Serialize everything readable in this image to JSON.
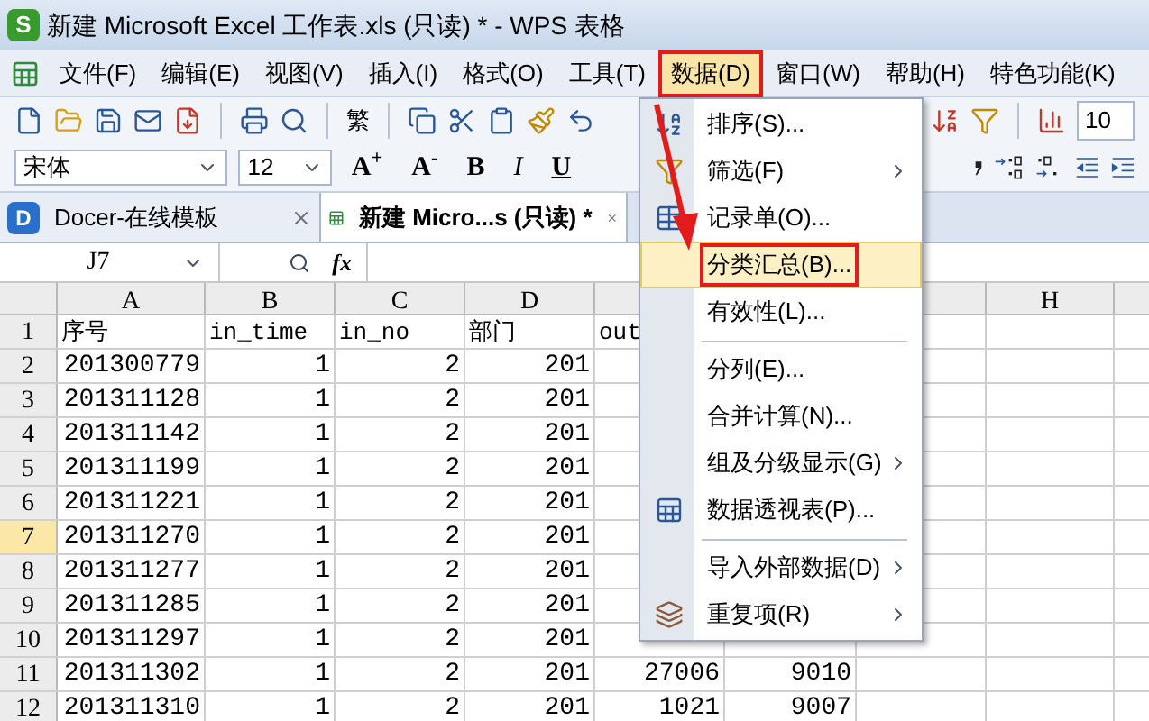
{
  "title_bar": {
    "logo_letter": "S",
    "title": "新建 Microsoft Excel 工作表.xls (只读) * - WPS 表格"
  },
  "menu_bar": [
    {
      "label": "文件(F)",
      "selected": false,
      "marked": false
    },
    {
      "label": "编辑(E)",
      "selected": false,
      "marked": false
    },
    {
      "label": "视图(V)",
      "selected": false,
      "marked": false
    },
    {
      "label": "插入(I)",
      "selected": false,
      "marked": false
    },
    {
      "label": "格式(O)",
      "selected": false,
      "marked": false
    },
    {
      "label": "工具(T)",
      "selected": false,
      "marked": false
    },
    {
      "label": "数据(D)",
      "selected": true,
      "marked": true
    },
    {
      "label": "窗口(W)",
      "selected": false,
      "marked": false
    },
    {
      "label": "帮助(H)",
      "selected": false,
      "marked": false
    },
    {
      "label": "特色功能(K)",
      "selected": false,
      "marked": false
    }
  ],
  "toolbar": {
    "traditional_button": "繁",
    "zoom_field": "10"
  },
  "format_bar": {
    "font_field": "宋体",
    "size_field": "12",
    "buttons": [
      "A$^{+}$",
      "A$^{-}$",
      "B",
      "I",
      "U"
    ]
  },
  "tabs": [
    {
      "kind": "docer",
      "logo_letter": "D",
      "label": "Docer-在线模板",
      "selected": false
    },
    {
      "kind": "workbook",
      "label": "新建 Micro...s (只读) *",
      "selected": true
    }
  ],
  "formula_bar": {
    "name_box": "J7",
    "fx": "fx"
  },
  "sheet": {
    "columns": [
      "A",
      "B",
      "C",
      "D",
      null,
      null,
      null,
      "H"
    ],
    "rows": [
      {
        "header": "1",
        "selected": false,
        "kind": "labels",
        "cells": [
          "序号",
          "in_time",
          "in_no",
          "部门",
          "out"
        ]
      },
      {
        "header": "2",
        "selected": false,
        "kind": "values",
        "cells": [
          "201300779",
          "1",
          "2",
          "201"
        ]
      },
      {
        "header": "3",
        "selected": false,
        "kind": "values",
        "cells": [
          "201311128",
          "1",
          "2",
          "201"
        ]
      },
      {
        "header": "4",
        "selected": false,
        "kind": "values",
        "cells": [
          "201311142",
          "1",
          "2",
          "201"
        ]
      },
      {
        "header": "5",
        "selected": false,
        "kind": "values",
        "cells": [
          "201311199",
          "1",
          "2",
          "201"
        ]
      },
      {
        "header": "6",
        "selected": false,
        "kind": "values",
        "cells": [
          "201311221",
          "1",
          "2",
          "201"
        ]
      },
      {
        "header": "7",
        "selected": true,
        "kind": "values",
        "cells": [
          "201311270",
          "1",
          "2",
          "201"
        ]
      },
      {
        "header": "8",
        "selected": false,
        "kind": "values",
        "cells": [
          "201311277",
          "1",
          "2",
          "201"
        ]
      },
      {
        "header": "9",
        "selected": false,
        "kind": "values",
        "cells": [
          "201311285",
          "1",
          "2",
          "201"
        ]
      },
      {
        "header": "10",
        "selected": false,
        "kind": "values",
        "cells": [
          "201311297",
          "1",
          "2",
          "201"
        ]
      },
      {
        "header": "11",
        "selected": false,
        "kind": "values",
        "cells": [
          "201311302",
          "1",
          "2",
          "201",
          "27006",
          "9010"
        ]
      },
      {
        "header": "12",
        "selected": false,
        "kind": "values",
        "cells": [
          "201311310",
          "1",
          "2",
          "201",
          "1021",
          "9007"
        ]
      }
    ]
  },
  "data_menu": [
    {
      "kind": "item",
      "label": "排序(S)...",
      "submenu": false,
      "selected": false,
      "marked": false
    },
    {
      "kind": "item",
      "label": "筛选(F)",
      "submenu": true,
      "selected": false,
      "marked": false
    },
    {
      "kind": "item",
      "label": "记录单(O)...",
      "submenu": false,
      "selected": false,
      "marked": false
    },
    {
      "kind": "item",
      "label": "分类汇总(B)...",
      "submenu": false,
      "selected": true,
      "marked": true
    },
    {
      "kind": "item",
      "label": "有效性(L)...",
      "submenu": false,
      "selected": false,
      "marked": false
    },
    {
      "kind": "separator"
    },
    {
      "kind": "item",
      "label": "分列(E)...",
      "submenu": false,
      "selected": false,
      "marked": false
    },
    {
      "kind": "item",
      "label": "合并计算(N)...",
      "submenu": false,
      "selected": false,
      "marked": false
    },
    {
      "kind": "item",
      "label": "组及分级显示(G)",
      "submenu": true,
      "selected": false,
      "marked": false
    },
    {
      "kind": "item",
      "label": "数据透视表(P)...",
      "submenu": false,
      "selected": false,
      "marked": false
    },
    {
      "kind": "separator"
    },
    {
      "kind": "item",
      "label": "导入外部数据(D)",
      "submenu": true,
      "selected": false,
      "marked": false
    },
    {
      "kind": "item",
      "label": "重复项(R)",
      "submenu": true,
      "selected": false,
      "marked": false
    }
  ]
}
